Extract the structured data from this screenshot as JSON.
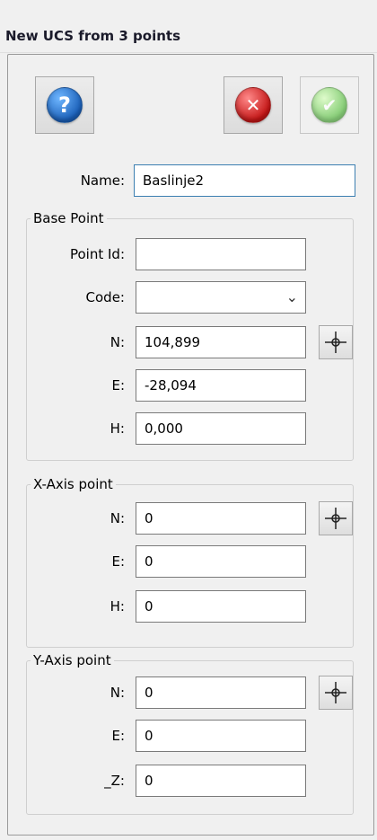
{
  "window": {
    "title": "New UCS from 3 points"
  },
  "toolbar": {
    "help_icon": "question-icon",
    "cancel_icon": "x-icon",
    "ok_icon": "check-icon",
    "help_glyph": "?",
    "cancel_glyph": "✕",
    "ok_glyph": "✔",
    "colors": {
      "help": "#1a5fb8",
      "cancel": "#c41616",
      "ok": "#5fc04a"
    }
  },
  "name": {
    "label": "Name:",
    "value": "Baslinje2"
  },
  "base_point": {
    "title": "Base Point",
    "point_id": {
      "label": "Point Id:",
      "value": ""
    },
    "code": {
      "label": "Code:",
      "value": ""
    },
    "n": {
      "label": "N:",
      "value": "104,899"
    },
    "e": {
      "label": "E:",
      "value": "-28,094"
    },
    "h": {
      "label": "H:",
      "value": "0,000"
    }
  },
  "x_axis": {
    "title": "X-Axis point",
    "n": {
      "label": "N:",
      "value": "0"
    },
    "e": {
      "label": "E:",
      "value": "0"
    },
    "h": {
      "label": "H:",
      "value": "0"
    }
  },
  "y_axis": {
    "title": "Y-Axis point",
    "n": {
      "label": "N:",
      "value": "0"
    },
    "e": {
      "label": "E:",
      "value": "0"
    },
    "z": {
      "label": "_Z:",
      "value": "0"
    }
  },
  "pick_icon": "crosshair-icon"
}
